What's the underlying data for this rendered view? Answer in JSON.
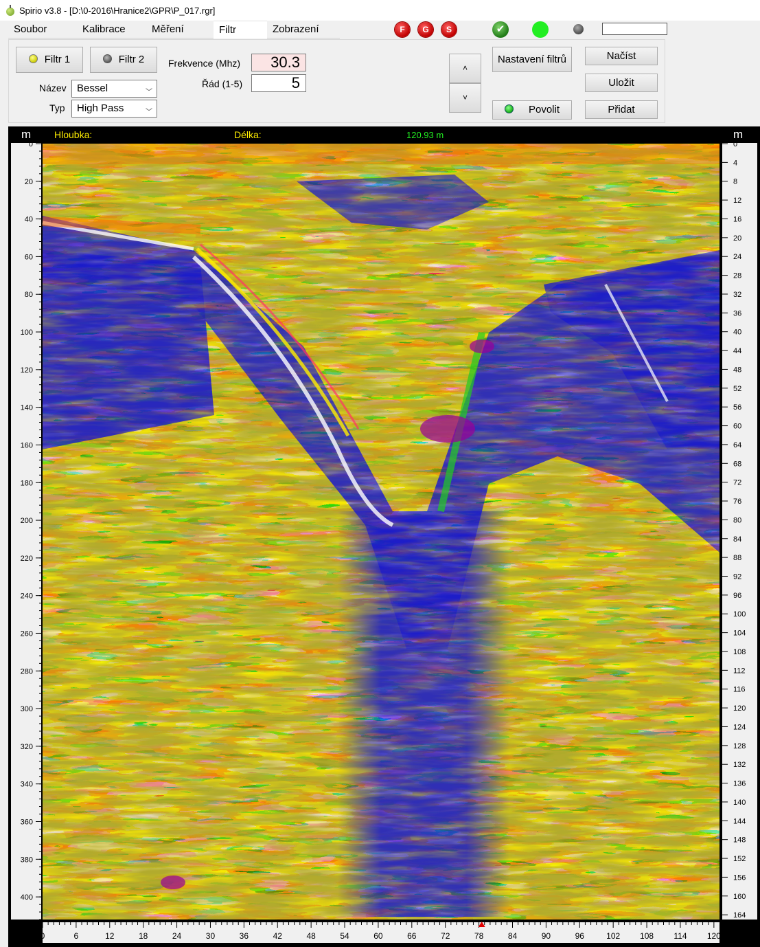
{
  "window": {
    "title": "Spirio v3.8 - [D:\\0-2016\\Hranice2\\GPR\\P_017.rgr]"
  },
  "tabs": [
    {
      "label": "Soubor",
      "active": false
    },
    {
      "label": "Kalibrace",
      "active": false
    },
    {
      "label": "Měření",
      "active": false
    },
    {
      "label": "Filtr",
      "active": true
    },
    {
      "label": "Zobrazení",
      "active": false
    }
  ],
  "indicators": {
    "f": "F",
    "g": "G",
    "s": "S",
    "ok_icon": "check-icon",
    "accent_red": "#d00000",
    "led_green": "#22ee22"
  },
  "filter": {
    "filtr1_label": "Filtr 1",
    "filtr2_label": "Filtr 2",
    "filtr1_led": "#e8e800",
    "filtr2_led": "#888888",
    "nazev_label": "Název",
    "nazev_value": "Bessel",
    "typ_label": "Typ",
    "typ_value": "High Pass",
    "frekvence_label": "Frekvence (Mhz)",
    "frekvence_value": "30.3",
    "rad_label": "Řád (1-5)",
    "rad_value": "5",
    "up_label": "˄",
    "down_label": "˅",
    "nastaveni_label": "Nastavení filtrů",
    "povolit_label": "Povolit",
    "nacist_label": "Načíst",
    "ulozit_label": "Uložit",
    "pridat_label": "Přidat"
  },
  "radargram": {
    "unit_left": "m",
    "unit_right": "m",
    "hloubka_label": "Hloubka:",
    "delka_label": "Délka:",
    "length_value": "120.93 m",
    "left_ticks": [
      0,
      20,
      40,
      60,
      80,
      100,
      120,
      140,
      160,
      180,
      200,
      220,
      240,
      260,
      280,
      300,
      320,
      340,
      360,
      380,
      400
    ],
    "right_ticks": [
      0,
      4,
      8,
      12,
      16,
      20,
      24,
      28,
      32,
      36,
      40,
      44,
      48,
      52,
      56,
      60,
      64,
      68,
      72,
      76,
      80,
      84,
      88,
      92,
      96,
      100,
      104,
      108,
      112,
      116,
      120,
      124,
      128,
      132,
      136,
      140,
      144,
      148,
      152,
      156,
      160,
      164
    ],
    "bottom_ticks": [
      0,
      6,
      12,
      18,
      24,
      30,
      36,
      42,
      48,
      54,
      60,
      66,
      72,
      78,
      84,
      90,
      96,
      102,
      108,
      114,
      120
    ],
    "marker_position": 78.5,
    "palette": [
      "#1a1acc",
      "#ffffff",
      "#22cc22",
      "#ffdd00",
      "#ff6600",
      "#ff3366",
      "#006666",
      "#990099"
    ]
  }
}
